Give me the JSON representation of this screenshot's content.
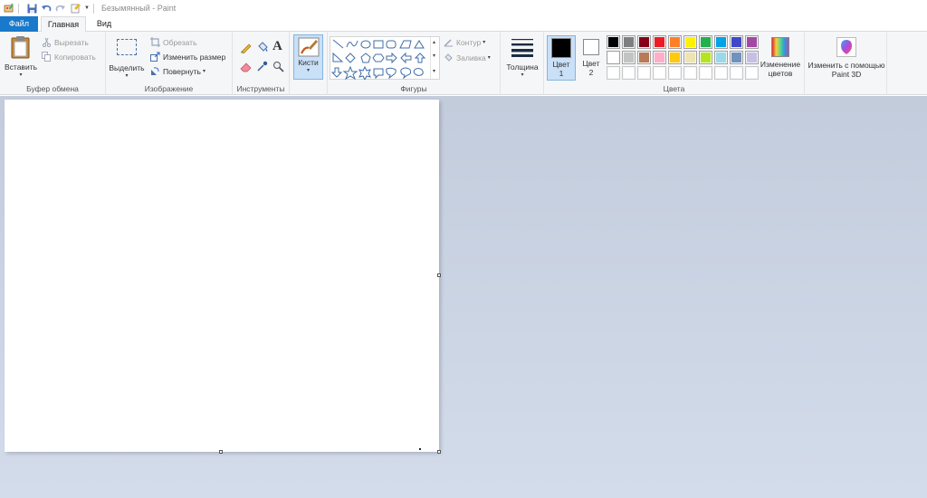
{
  "window": {
    "title": "Безымянный - Paint"
  },
  "tabs": {
    "file": "Файл",
    "home": "Главная",
    "view": "Вид"
  },
  "clipboard": {
    "paste": "Вставить",
    "cut": "Вырезать",
    "copy": "Копировать",
    "label": "Буфер обмена"
  },
  "image": {
    "select": "Выделить",
    "crop": "Обрезать",
    "resize": "Изменить размер",
    "rotate": "Повернуть",
    "label": "Изображение"
  },
  "tools": {
    "label": "Инструменты"
  },
  "brushes": {
    "label": "Кисти"
  },
  "shapes": {
    "outline": "Контур",
    "fill": "Заливка",
    "label": "Фигуры"
  },
  "size": {
    "label": "Толщина"
  },
  "colors": {
    "color1": "Цвет",
    "color1_num": "1",
    "color2": "Цвет",
    "color2_num": "2",
    "edit": "Изменение цветов",
    "label": "Цвета",
    "color1_value": "#000000",
    "color2_value": "#ffffff",
    "palette": [
      [
        "#000000",
        "#7f7f7f",
        "#880015",
        "#ed1c24",
        "#ff7f27",
        "#fff200",
        "#22b14c",
        "#00a2e8",
        "#3f48cc",
        "#a349a4"
      ],
      [
        "#ffffff",
        "#c3c3c3",
        "#b97a57",
        "#ffaec9",
        "#ffc90e",
        "#efe4b0",
        "#b5e61d",
        "#99d9ea",
        "#7092be",
        "#c8bfe7"
      ],
      [
        "",
        "",
        "",
        "",
        "",
        "",
        "",
        "",
        "",
        ""
      ]
    ]
  },
  "paint3d": {
    "label": "Изменить с помощью Paint 3D"
  }
}
